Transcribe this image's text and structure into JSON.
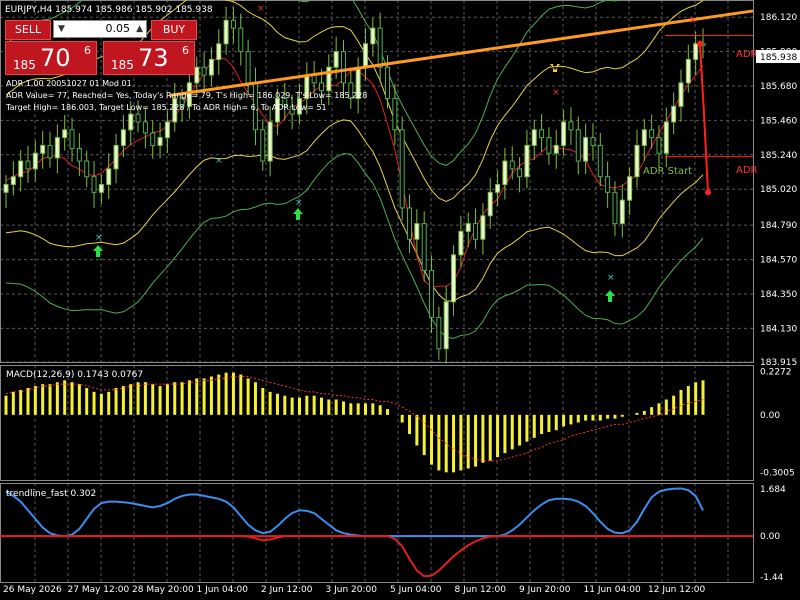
{
  "header": {
    "symbol_info": "EURJPY,H4 185.974 185.986 185.902 185.938"
  },
  "trade_panel": {
    "sell_label": "SELL",
    "buy_label": "BUY",
    "lot": "0.05",
    "bid": {
      "small": "185",
      "big": "70",
      "sup": "6"
    },
    "ask": {
      "small": "185",
      "big": "73",
      "sup": "6"
    }
  },
  "info_lines": [
    "ADR 1.00 20051027 01 Mod 01",
    "ADR Value= 77, Reached= Yes, Today's Range= 79, T's High= 186.029, T's Low= 185.228",
    "Target High= 186.003, Target Low= 185.228 / To ADR High= 6, To ADR Low= 51"
  ],
  "colors": {
    "candle_bull": "#ffffff",
    "candle_body_bull": "#e8f5d0",
    "wick": "#7fbf3f",
    "band_yellow": "#e8d04a",
    "band_green": "#4caf50",
    "ma_red": "#e02020",
    "trendline": "#ff9a1f",
    "adr_red": "#ff2020",
    "macd_hist": "#f5f030",
    "macd_signal": "#ff3030",
    "fast_blue": "#3a8ef0",
    "fast_red": "#e02020",
    "grid": "#5a5a5a"
  },
  "chart_data": [
    {
      "type": "candlestick",
      "title": "EURJPY,H4",
      "price_ticks": [
        "186.120",
        "185.900",
        "185.680",
        "185.460",
        "185.240",
        "185.020",
        "184.790",
        "184.570",
        "184.350",
        "184.130",
        "183.915"
      ],
      "ylim": [
        183.915,
        186.23
      ],
      "current_price": "185.938",
      "x_labels": [
        "26 May 2026",
        "27 May 12:00",
        "28 May 20:00",
        "1 Jun 04:00",
        "2 Jun 12:00",
        "3 Jun 20:00",
        "5 Jun 04:00",
        "8 Jun 12:00",
        "9 Jun 20:00",
        "11 Jun 04:00",
        "12 Jun 12:00"
      ],
      "annotations": [
        "ADR",
        "ADR",
        "ADR Start"
      ],
      "levels": {
        "adr_high": 186.003,
        "adr_low": 185.228
      },
      "close_series": [
        185.05,
        185.1,
        185.2,
        185.15,
        185.25,
        185.3,
        185.22,
        185.35,
        185.4,
        185.28,
        185.2,
        185.1,
        185.0,
        185.05,
        185.15,
        185.3,
        185.4,
        185.5,
        185.45,
        185.38,
        185.3,
        185.35,
        185.45,
        185.6,
        185.55,
        185.7,
        185.8,
        185.75,
        185.85,
        185.95,
        186.1,
        186.05,
        185.9,
        185.7,
        185.4,
        185.2,
        185.45,
        185.6,
        185.55,
        185.5,
        185.6,
        185.75,
        185.7,
        185.65,
        185.8,
        185.9,
        185.7,
        185.6,
        185.8,
        185.95,
        186.05,
        185.8,
        185.6,
        185.4,
        184.9,
        184.7,
        184.8,
        184.5,
        184.2,
        184.0,
        184.3,
        184.6,
        184.75,
        184.8,
        184.7,
        184.85,
        185.0,
        185.05,
        185.2,
        185.15,
        185.1,
        185.3,
        185.4,
        185.35,
        185.25,
        185.3,
        185.45,
        185.4,
        185.2,
        185.35,
        185.3,
        185.1,
        185.0,
        184.8,
        184.95,
        185.1,
        185.3,
        185.4,
        185.35,
        185.25,
        185.45,
        185.55,
        185.7,
        185.85,
        185.95,
        185.94
      ],
      "trendline": {
        "start": 185.62,
        "end": 186.16
      }
    },
    {
      "type": "bar",
      "title": "MACD(12,26,9) 0.1743 0.0767",
      "yticks": [
        "0.2272",
        "0.00",
        "-0.3005"
      ],
      "ylim": [
        -0.34,
        0.26
      ],
      "values": [
        0.1,
        0.12,
        0.13,
        0.14,
        0.15,
        0.16,
        0.16,
        0.17,
        0.18,
        0.17,
        0.16,
        0.14,
        0.12,
        0.11,
        0.12,
        0.14,
        0.15,
        0.16,
        0.17,
        0.17,
        0.16,
        0.15,
        0.16,
        0.17,
        0.17,
        0.18,
        0.19,
        0.19,
        0.2,
        0.21,
        0.22,
        0.22,
        0.21,
        0.19,
        0.17,
        0.14,
        0.12,
        0.11,
        0.1,
        0.09,
        0.09,
        0.1,
        0.1,
        0.09,
        0.08,
        0.08,
        0.07,
        0.06,
        0.06,
        0.06,
        0.06,
        0.05,
        0.03,
        0.0,
        -0.04,
        -0.1,
        -0.16,
        -0.21,
        -0.26,
        -0.29,
        -0.3,
        -0.3,
        -0.29,
        -0.28,
        -0.27,
        -0.25,
        -0.24,
        -0.22,
        -0.2,
        -0.18,
        -0.16,
        -0.14,
        -0.12,
        -0.1,
        -0.09,
        -0.08,
        -0.06,
        -0.05,
        -0.04,
        -0.03,
        -0.03,
        -0.03,
        -0.02,
        -0.02,
        -0.01,
        0.0,
        0.01,
        0.02,
        0.04,
        0.06,
        0.08,
        0.1,
        0.13,
        0.15,
        0.17,
        0.18
      ],
      "signal": [
        0.11,
        0.12,
        0.12,
        0.13,
        0.14,
        0.15,
        0.15,
        0.16,
        0.16,
        0.16,
        0.16,
        0.15,
        0.14,
        0.13,
        0.13,
        0.13,
        0.14,
        0.15,
        0.15,
        0.16,
        0.16,
        0.16,
        0.16,
        0.16,
        0.16,
        0.17,
        0.17,
        0.18,
        0.18,
        0.19,
        0.19,
        0.2,
        0.2,
        0.2,
        0.19,
        0.18,
        0.17,
        0.16,
        0.15,
        0.14,
        0.13,
        0.12,
        0.12,
        0.11,
        0.11,
        0.1,
        0.1,
        0.09,
        0.09,
        0.08,
        0.08,
        0.07,
        0.07,
        0.06,
        0.04,
        0.02,
        -0.01,
        -0.04,
        -0.08,
        -0.12,
        -0.15,
        -0.18,
        -0.2,
        -0.22,
        -0.23,
        -0.24,
        -0.24,
        -0.24,
        -0.23,
        -0.22,
        -0.21,
        -0.2,
        -0.18,
        -0.17,
        -0.15,
        -0.14,
        -0.13,
        -0.11,
        -0.1,
        -0.09,
        -0.08,
        -0.07,
        -0.06,
        -0.05,
        -0.05,
        -0.04,
        -0.03,
        -0.02,
        -0.01,
        0.0,
        0.02,
        0.03,
        0.05,
        0.06,
        0.07,
        0.08
      ]
    },
    {
      "type": "line",
      "title": "trendline_fast 0.302",
      "yticks": [
        "1.684",
        "0.00",
        "-1.44"
      ],
      "ylim": [
        -1.6,
        1.85
      ],
      "positive": [
        1.55,
        1.4,
        1.2,
        0.9,
        0.6,
        0.3,
        0.1,
        0.02,
        0.0,
        0.05,
        0.25,
        0.6,
        0.95,
        1.15,
        1.2,
        1.2,
        1.18,
        1.15,
        1.1,
        1.05,
        1.0,
        1.05,
        1.15,
        1.3,
        1.4,
        1.45,
        1.45,
        1.4,
        1.35,
        1.3,
        1.2,
        1.0,
        0.7,
        0.4,
        0.2,
        0.1,
        0.15,
        0.35,
        0.6,
        0.8,
        0.9,
        0.88,
        0.8,
        0.6,
        0.4,
        0.2,
        0.1,
        0.05,
        0.02,
        0.0,
        0.0,
        0.0,
        0.0,
        0.0,
        0.0,
        0.0,
        0.0,
        0.0,
        0.0,
        0.0,
        0.0,
        0.0,
        0.0,
        0.0,
        0.0,
        0.0,
        0.0,
        0.0,
        0.05,
        0.2,
        0.4,
        0.65,
        0.9,
        1.1,
        1.25,
        1.3,
        1.3,
        1.28,
        1.2,
        1.05,
        0.8,
        0.5,
        0.25,
        0.12,
        0.1,
        0.2,
        0.5,
        0.95,
        1.35,
        1.55,
        1.62,
        1.65,
        1.66,
        1.6,
        1.4,
        0.9
      ],
      "negative": [
        0,
        0,
        0,
        0,
        0,
        0,
        0,
        0,
        0,
        0,
        0,
        0,
        0,
        0,
        0,
        0,
        0,
        0,
        0,
        0,
        0,
        0,
        0,
        0,
        0,
        0,
        0,
        0,
        0,
        0,
        0,
        0,
        0,
        -0.02,
        -0.08,
        -0.15,
        -0.12,
        -0.05,
        0,
        0,
        0,
        0,
        0,
        0,
        0,
        0,
        0,
        0,
        0,
        0,
        0,
        0,
        0,
        -0.1,
        -0.35,
        -0.8,
        -1.2,
        -1.4,
        -1.38,
        -1.2,
        -0.95,
        -0.7,
        -0.5,
        -0.32,
        -0.18,
        -0.08,
        -0.02,
        0,
        0,
        0,
        0,
        0,
        0,
        0,
        0,
        0,
        0,
        0,
        0,
        0,
        0,
        0,
        0,
        0,
        0,
        0,
        0,
        0,
        0,
        0,
        0,
        0,
        0,
        0,
        0,
        0
      ]
    }
  ]
}
